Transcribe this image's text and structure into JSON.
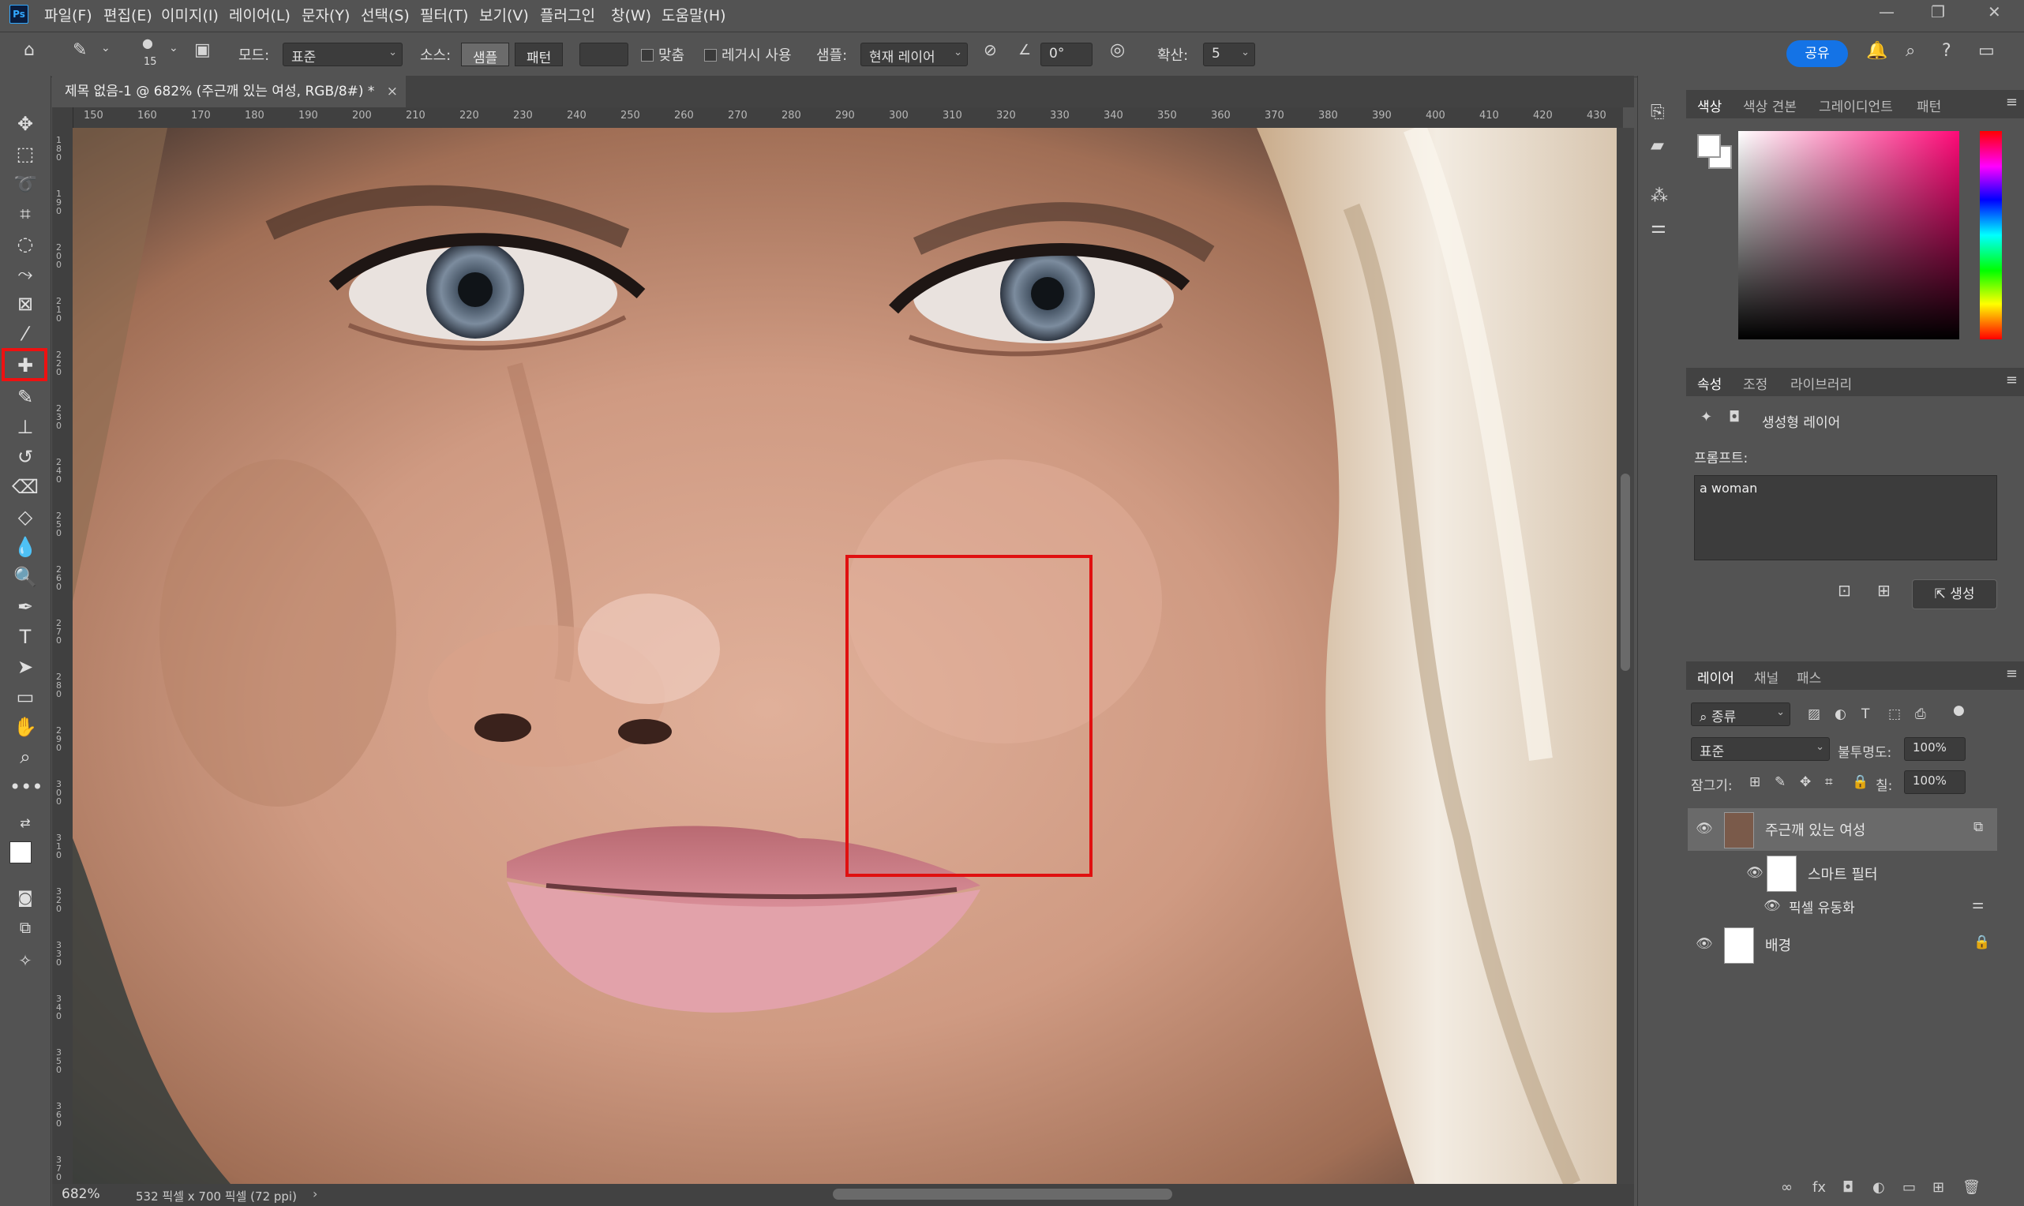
{
  "app": {
    "logo": "Ps",
    "menu": [
      "파일(F)",
      "편집(E)",
      "이미지(I)",
      "레이어(L)",
      "문자(Y)",
      "선택(S)",
      "필터(T)",
      "보기(V)",
      "플러그인",
      "창(W)",
      "도움말(H)"
    ],
    "window_controls": [
      "—",
      "❐",
      "✕"
    ]
  },
  "options": {
    "brush_size": "15",
    "mode_label": "모드:",
    "mode_value": "표준",
    "source_label": "소스:",
    "source_sampled": "샘플",
    "source_pattern": "패턴",
    "align_label": "맞춤",
    "legacy_label": "레거시 사용",
    "sample_label": "샘플:",
    "sample_value": "현재 레이어",
    "angle_value": "0°",
    "diffusion_label": "확산:",
    "diffusion_value": "5",
    "share_label": "공유"
  },
  "document": {
    "tab_title": "제목 없음-1 @ 682% (주근깨 있는 여성, RGB/8#) *",
    "tab_close": "×",
    "zoom": "682%",
    "doc_info": "532 픽셀 x 700 픽셀 (72 ppi)",
    "ruler_h": [
      "150",
      "160",
      "170",
      "180",
      "190",
      "200",
      "210",
      "220",
      "230",
      "240",
      "250",
      "260",
      "270",
      "280",
      "290",
      "300",
      "310",
      "320",
      "330",
      "340",
      "350",
      "360",
      "370",
      "380",
      "390",
      "400",
      "410",
      "420",
      "430"
    ],
    "ruler_v": [
      "180",
      "190",
      "200",
      "210",
      "220",
      "230",
      "240",
      "250",
      "260",
      "270",
      "280",
      "290",
      "300",
      "310",
      "320",
      "330",
      "340",
      "350",
      "360",
      "370"
    ]
  },
  "color_panel": {
    "tabs": [
      "색상",
      "색상 견본",
      "그레이디언트",
      "패턴"
    ],
    "foreground": "#ffffff",
    "background": "#ffffff"
  },
  "properties_panel": {
    "tabs": [
      "속성",
      "조정",
      "라이브러리"
    ],
    "layer_type": "생성형 레이어",
    "prompt_label": "프롬프트:",
    "prompt_value": "a woman",
    "generate_label": "생성"
  },
  "layers_panel": {
    "tabs": [
      "레이어",
      "채널",
      "패스"
    ],
    "filter_kind": "종류",
    "blend_mode": "표준",
    "opacity_label": "불투명도:",
    "opacity_value": "100%",
    "lock_label": "잠그기:",
    "fill_label": "칠:",
    "fill_value": "100%",
    "layers": [
      {
        "name": "주근깨 있는 여성"
      },
      {
        "name": "스마트 필터"
      },
      {
        "name": "픽셀 유동화"
      },
      {
        "name": "배경"
      }
    ]
  },
  "colors": {
    "accent": "#1473e6",
    "highlight_box": "#e01010"
  }
}
